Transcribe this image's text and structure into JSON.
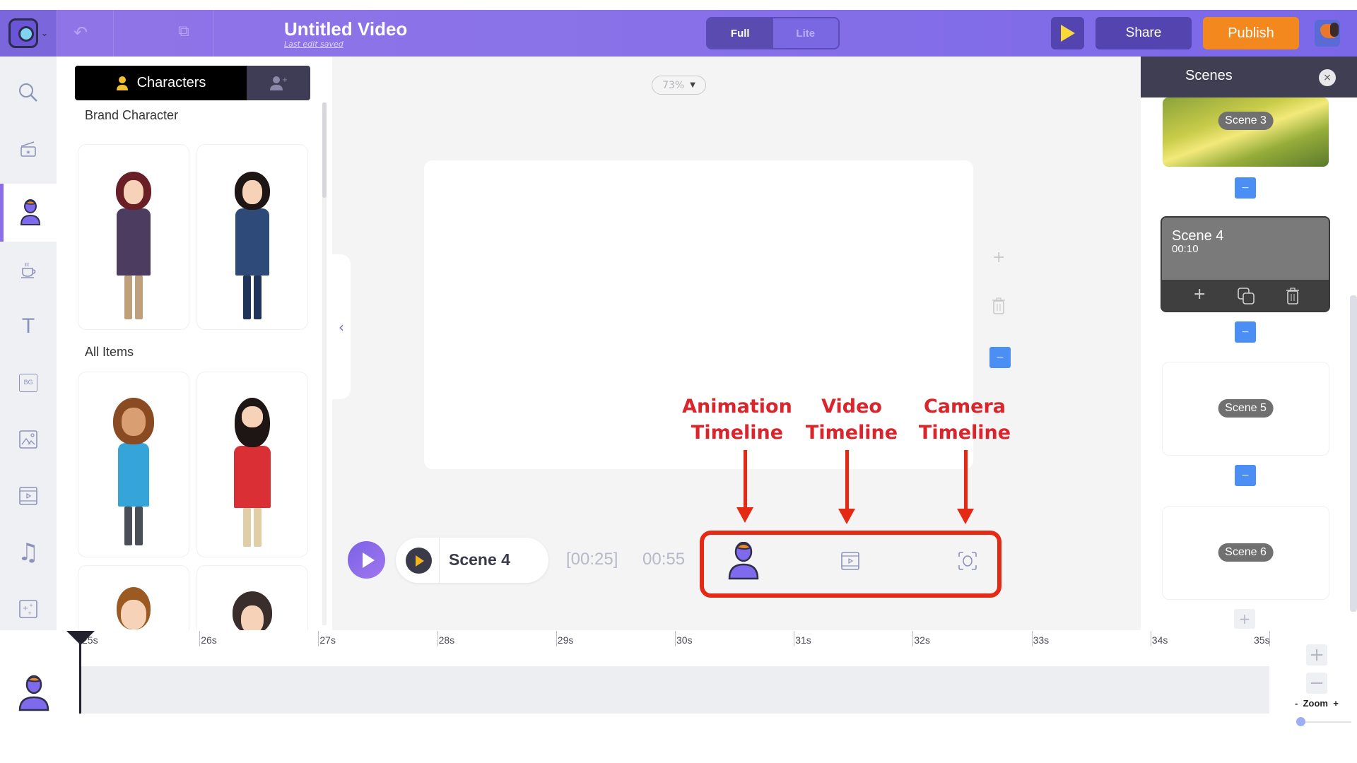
{
  "header": {
    "title": "Untitled Video",
    "subtitle": "Last edit saved",
    "mode_options": [
      "Full",
      "Lite"
    ],
    "mode_selected": "Full",
    "share_label": "Share",
    "publish_label": "Publish",
    "icons": {
      "logo": "app-logo-icon",
      "undo": "undo-icon",
      "duplicate": "duplicate-icon",
      "play": "play-icon"
    }
  },
  "icon_sidebar": {
    "items": [
      {
        "name": "search",
        "icon": "search-icon"
      },
      {
        "name": "templates",
        "icon": "clapperboard-star-icon"
      },
      {
        "name": "characters",
        "icon": "character-icon",
        "active": true
      },
      {
        "name": "properties",
        "icon": "coffee-cup-icon"
      },
      {
        "name": "text",
        "icon": "text-icon",
        "glyph": "T"
      },
      {
        "name": "backgrounds",
        "icon": "bg-icon",
        "glyph": "BG"
      },
      {
        "name": "images",
        "icon": "image-icon"
      },
      {
        "name": "videos",
        "icon": "video-icon"
      },
      {
        "name": "music",
        "icon": "music-icon",
        "glyph": "♫"
      },
      {
        "name": "effects",
        "icon": "sparkle-icon"
      }
    ]
  },
  "library": {
    "tab_active": "Characters",
    "sections": [
      {
        "label": "Brand Character",
        "items": [
          "Woman burgundy hair",
          "Woman blue blazer"
        ]
      },
      {
        "label": "All Items",
        "items": [
          "Woman glasses blue jacket",
          "Bearded man red shirt",
          "Man brown hair",
          "Woman dark hair"
        ]
      }
    ]
  },
  "stage": {
    "zoom_level": "73%",
    "collapse_glyph": "‹",
    "tools": {
      "add": "+",
      "minus": "−"
    }
  },
  "annotations": [
    {
      "line1": "Animation",
      "line2": "Timeline"
    },
    {
      "line1": "Video",
      "line2": "Timeline"
    },
    {
      "line1": "Camera",
      "line2": "Timeline"
    }
  ],
  "playback": {
    "scene_name": "Scene 4",
    "scene_range": "[00:25]",
    "total_time": "00:55"
  },
  "scenes_panel": {
    "title": "Scenes",
    "close_glyph": "×",
    "scenes": [
      {
        "label": "Scene 3"
      },
      {
        "label": "Scene 4",
        "duration": "00:10",
        "active": true
      },
      {
        "label": "Scene 5"
      },
      {
        "label": "Scene 6"
      }
    ],
    "action_glyphs": {
      "add": "+",
      "minus": "−"
    }
  },
  "timeline": {
    "ticks": [
      "25s",
      "26s",
      "27s",
      "28s",
      "29s",
      "30s",
      "31s",
      "32s",
      "33s",
      "34s",
      "35s"
    ],
    "zoom_label": "Zoom",
    "zoom_minus": "-",
    "zoom_plus": "+",
    "zoom_value": 0,
    "zoom_in_glyph": "+",
    "zoom_out_glyph": "−"
  }
}
